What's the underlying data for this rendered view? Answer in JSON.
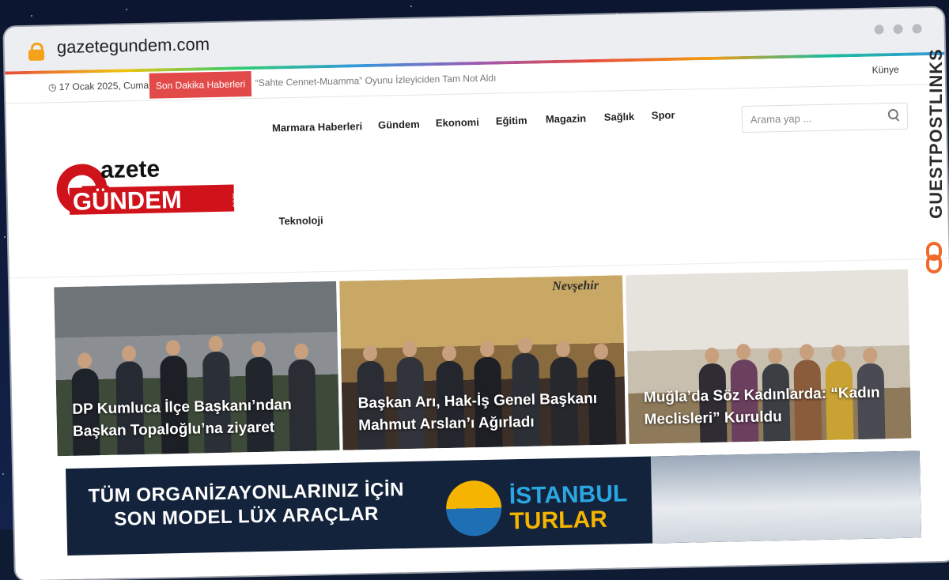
{
  "browser": {
    "url": "gazetegundem.com"
  },
  "topbar": {
    "date": "17 Ocak 2025, Cuma",
    "breaking_label": "Son Dakika Haberleri",
    "breaking_text": "“Sahte Cennet-Muamma” Oyunu İzleyiciden Tam Not Aldı",
    "kunye": "Künye"
  },
  "logo": {
    "line1": "azete",
    "line2": "GÜNDEM",
    "tld": ".com",
    "brand_color": "#d0121b"
  },
  "nav": {
    "items": [
      "Marmara Haberleri",
      "Gündem",
      "Ekonomi",
      "Eğitim",
      "Magazin",
      "Sağlık",
      "Spor",
      "Teknoloji"
    ]
  },
  "search": {
    "placeholder": "Arama yap ..."
  },
  "headlines": [
    {
      "title": "DP Kumluca İlçe Başkanı’ndan Başkan Topaloğlu’na ziyaret"
    },
    {
      "title": "Başkan Arı, Hak-İş Genel Başkanı Mahmut Arslan’ı Ağırladı",
      "scene_text": "Nevşehir"
    },
    {
      "title": "Muğla’da Söz Kadınlarda: “Kadın Meclisleri” Kuruldu"
    }
  ],
  "banner": {
    "line1": "TÜM ORGANİZAYONLARINIZ İÇİN",
    "line2": "SON MODEL LÜX ARAÇLAR",
    "brand_line1": "İSTANBUL",
    "brand_line2": "TURLAR"
  },
  "watermark": {
    "text": "GUESTPOSTLINKS"
  }
}
